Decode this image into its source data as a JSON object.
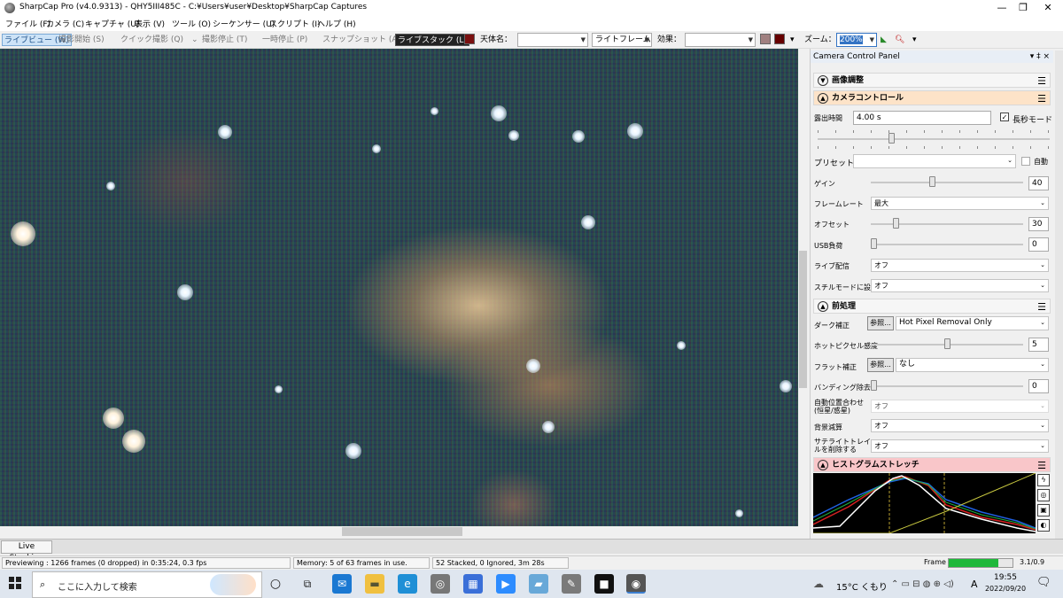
{
  "window": {
    "title": "SharpCap Pro (v4.0.9313) - QHY5III485C - C:¥Users¥user¥Desktop¥SharpCap Captures",
    "minimize": "—",
    "maximize": "❐",
    "close": "✕"
  },
  "menu": [
    "ファイル (F)",
    "カメラ (C)",
    "キャプチャ (U)",
    "表示 (V)",
    "ツール (O)",
    "シーケンサー (U)",
    "スクリプト (I)",
    "ヘルプ (H)"
  ],
  "toolbar": {
    "live_view": "ライブビュー (W)",
    "start_capture": "撮影開始 (S)",
    "quick_capture": "クイック撮影 (Q)",
    "stop_capture": "撮影停止 (T)",
    "pause": "一時停止 (P)",
    "snapshot": "スナップショット (A)",
    "live_stack": "ライブスタック (L)",
    "target_label": "天体名：",
    "target_value": "",
    "frame_type": "ライトフレーム",
    "effect_label": "効果：",
    "effect_value": "",
    "zoom_label": "ズーム：",
    "zoom_value": "200%"
  },
  "panel": {
    "title": "Camera Control Panel",
    "pin": "▾ ‡ ×",
    "sections": {
      "image_adjust": "画像調整",
      "camera_control": "カメラコントロール",
      "preprocess": "前処理",
      "histogram": "ヒストグラムストレッチ"
    },
    "exposure": {
      "label": "露出時間",
      "value": "4.00 s",
      "long_mode": "長秒モード",
      "long_checked": true
    },
    "preset": {
      "label": "プリセット",
      "value": "",
      "auto": "自動"
    },
    "gain": {
      "label": "ゲイン",
      "value": "40",
      "level": 40
    },
    "framerate": {
      "label": "フレームレート",
      "value": "最大"
    },
    "offset": {
      "label": "オフセット",
      "value": "30",
      "level": 30
    },
    "usb": {
      "label": "USB負荷",
      "value": "0",
      "level": 0
    },
    "live_stream": {
      "label": "ライブ配信",
      "value": "オフ"
    },
    "still_mode": {
      "label": "スチルモードに設定",
      "value": "オフ"
    },
    "dark": {
      "label": "ダーク補正",
      "browse": "参照...",
      "value": "Hot Pixel Removal Only"
    },
    "hot_pixel": {
      "label": "ホットピクセル感度",
      "value": "5",
      "level": 5
    },
    "flat": {
      "label": "フラット補正",
      "browse": "参照...",
      "value": "なし"
    },
    "banding": {
      "label": "バンディング除去",
      "value": "0",
      "level": 0
    },
    "auto_align": {
      "label": "自動位置合わせ(恒星/惑星)",
      "value": "オフ"
    },
    "bg_sub": {
      "label": "背景減算",
      "value": "オフ"
    },
    "satellite": {
      "label": "サテライトトレイルを削除する",
      "value": "オフ"
    }
  },
  "livestack_tab": "Live Stacking",
  "status": {
    "preview": "Previewing : 1266 frames (0 dropped) in 0:35:24, 0.3 fps",
    "memory": "Memory: 5 of 63 frames in use.",
    "stacked": "52 Stacked, 0 Ignored, 3m 28s",
    "frame_label": "Frame :",
    "frame_progress": 0.78,
    "frame_value": "3.1/0.9"
  },
  "taskbar": {
    "search_placeholder": "ここに入力して検索",
    "weather": "15°C くもり",
    "ime": "A",
    "time": "19:55",
    "date": "2022/09/20"
  },
  "colors": {
    "live_stack_accent": "#1a4f8a",
    "histogram_header": "#f9c6c9",
    "camera_header": "#fde3c8",
    "frame_bar": "#1fb83a"
  }
}
